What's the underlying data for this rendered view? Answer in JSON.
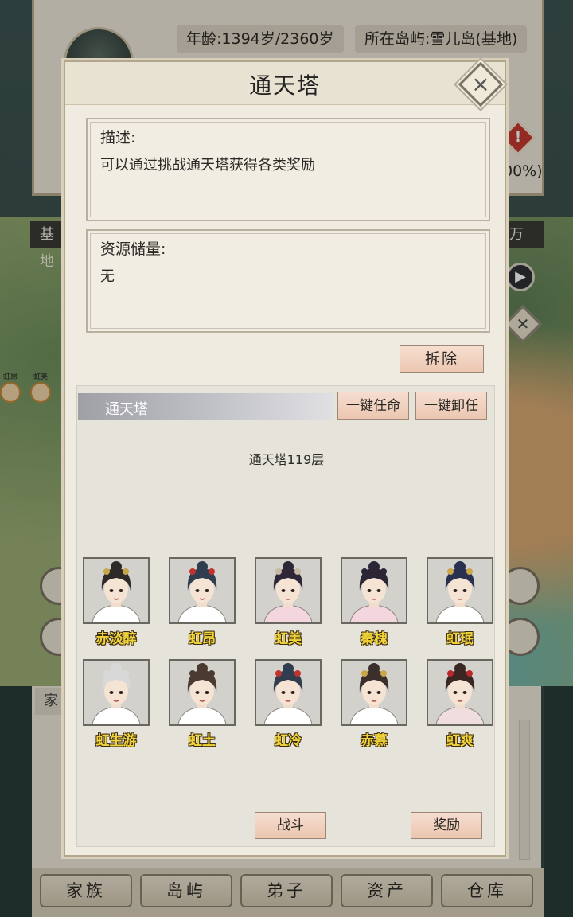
{
  "background": {
    "age_text": "年龄:1394岁/2360岁",
    "island_text": "所在岛屿:雪儿岛(基地)",
    "percent_text": "00%)",
    "base_label": "基地",
    "wan_label": "万",
    "lower_tab_label": "家",
    "map_names": [
      "虹昂",
      "虹美"
    ]
  },
  "modal": {
    "title": "通天塔",
    "description_label": "描述:",
    "description_text": "可以通过挑战通天塔获得各类奖励",
    "resources_label": "资源储量:",
    "resources_text": "无",
    "demolish_label": "拆除",
    "section_title": "通天塔",
    "appoint_all_label": "一键任命",
    "dismiss_all_label": "一键卸任",
    "floor_text": "通天塔119层",
    "fight_label": "战斗",
    "reward_label": "奖励",
    "disciples": [
      {
        "name": "赤淡醉",
        "hair": "#2d2a28",
        "robe": "#ffffff",
        "accent": "#c9a64a"
      },
      {
        "name": "虹昂",
        "hair": "#2f3d4f",
        "robe": "#ffffff",
        "accent": "#c2322e"
      },
      {
        "name": "虹美",
        "hair": "#2e2738",
        "robe": "#f3d6de",
        "accent": "#c7b8a0"
      },
      {
        "name": "秦槐",
        "hair": "#2c2536",
        "robe": "#f3d6de",
        "accent": "#2c2536"
      },
      {
        "name": "虹珉",
        "hair": "#2a3150",
        "robe": "#ffffff",
        "accent": "#c9a64a"
      },
      {
        "name": "虹生游",
        "hair": "#d8d8d8",
        "robe": "#ffffff",
        "accent": "#d8d8d8"
      },
      {
        "name": "虹土",
        "hair": "#4a3a32",
        "robe": "#ffffff",
        "accent": "#4a3a32"
      },
      {
        "name": "虹冷",
        "hair": "#2f3d4f",
        "robe": "#ffffff",
        "accent": "#c2322e"
      },
      {
        "name": "赤慕",
        "hair": "#3a2f2a",
        "robe": "#ffffff",
        "accent": "#c9a64a"
      },
      {
        "name": "虹爽",
        "hair": "#3a2724",
        "robe": "#f0dede",
        "accent": "#b8282a"
      }
    ]
  },
  "nav": {
    "items": [
      "家族",
      "岛屿",
      "弟子",
      "资产",
      "仓库"
    ]
  },
  "icons": {
    "close": "close-icon",
    "play": "play-icon",
    "warning": "warning-icon"
  }
}
